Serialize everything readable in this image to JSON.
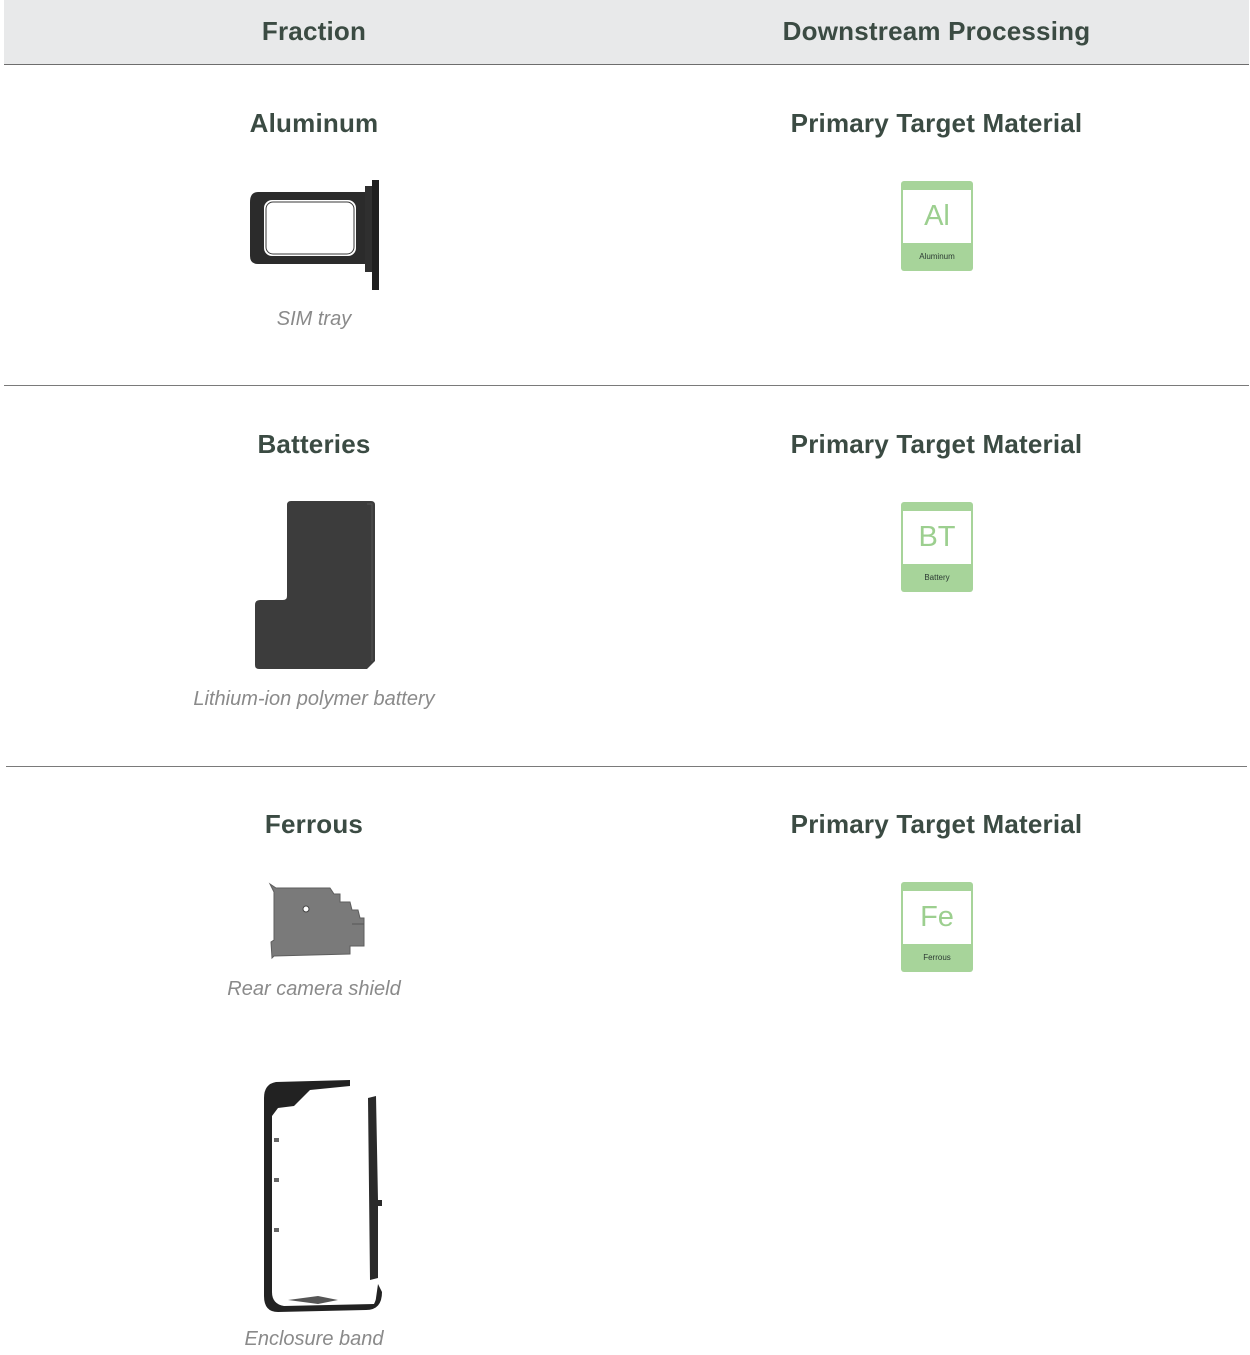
{
  "header": {
    "left_title": "Fraction",
    "right_title": "Downstream Processing"
  },
  "sections": [
    {
      "fraction": "Aluminum",
      "target_heading": "Primary Target Material",
      "items": [
        {
          "caption": "SIM tray",
          "icon": "sim-tray-icon"
        }
      ],
      "tile": {
        "symbol": "Al",
        "name": "Aluminum"
      }
    },
    {
      "fraction": "Batteries",
      "target_heading": "Primary Target Material",
      "items": [
        {
          "caption": "Lithium-ion polymer battery",
          "icon": "battery-icon"
        }
      ],
      "tile": {
        "symbol": "BT",
        "name": "Battery"
      }
    },
    {
      "fraction": "Ferrous",
      "target_heading": "Primary Target Material",
      "items": [
        {
          "caption": "Rear camera shield",
          "icon": "camera-shield-icon"
        },
        {
          "caption": "Enclosure band",
          "icon": "enclosure-band-icon"
        }
      ],
      "tile": {
        "symbol": "Fe",
        "name": "Ferrous"
      }
    }
  ],
  "colors": {
    "heading": "#3b4b43",
    "tile_green": "#a7d49a",
    "caption_gray": "#8a8a8a",
    "header_bg": "#e8e9ea"
  }
}
